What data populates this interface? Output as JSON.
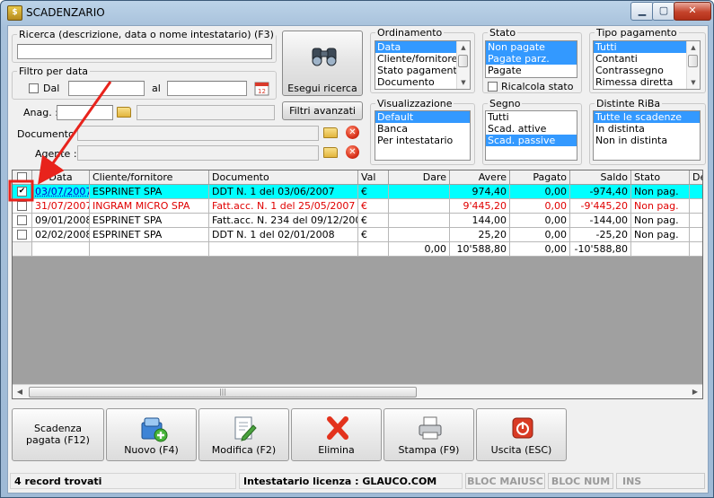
{
  "window": {
    "title": "SCADENZARIO",
    "min_glyph": "▁",
    "max_glyph": "▢",
    "close_glyph": "✕"
  },
  "search": {
    "label": "Ricerca (descrizione, data o nome intestatario) (F3)",
    "value": "",
    "button": "Esegui ricerca"
  },
  "date_filter": {
    "label": "Filtro per data",
    "from_label": "Dal",
    "from_value": "",
    "to_label": "al",
    "to_value": ""
  },
  "anag": {
    "label": "Anag. :",
    "code": "",
    "name": ""
  },
  "advanced_filters_button": "Filtri avanzati",
  "document": {
    "label": "Documento :",
    "value": ""
  },
  "agent": {
    "label": "Agente :",
    "value": ""
  },
  "ordinamento": {
    "title": "Ordinamento",
    "items": [
      "Data",
      "Cliente/fornitore",
      "Stato pagamento",
      "Documento"
    ],
    "selected": [
      0
    ]
  },
  "stato": {
    "title": "Stato",
    "items": [
      "Non pagate",
      "Pagate parz.",
      "Pagate"
    ],
    "selected": [
      0,
      1
    ],
    "recalc_label": "Ricalcola stato"
  },
  "tipo_pagamento": {
    "title": "Tipo pagamento",
    "items": [
      "Tutti",
      "Contanti",
      "Contrassegno",
      "Rimessa diretta"
    ],
    "selected": [
      0
    ]
  },
  "visualizzazione": {
    "title": "Visualizzazione",
    "items": [
      "Default",
      "Banca",
      "Per intestatario"
    ],
    "selected": [
      0
    ]
  },
  "segno": {
    "title": "Segno",
    "items": [
      "Tutti",
      "Scad. attive",
      "Scad. passive"
    ],
    "selected": [
      2
    ]
  },
  "distinte_riba": {
    "title": "Distinte RiBa",
    "items": [
      "Tutte le scadenze",
      "In distinta",
      "Non in distinta"
    ],
    "selected": [
      0
    ]
  },
  "grid": {
    "columns": [
      "",
      "Data",
      "Cliente/fornitore",
      "Documento",
      "Val",
      "Dare",
      "Avere",
      "Pagato",
      "Saldo",
      "Stato",
      "De"
    ],
    "rows": [
      {
        "checked": true,
        "highlight": true,
        "red": false,
        "data": "03/07/2007",
        "cliente": "ESPRINET SPA",
        "documento": "DDT N. 1 del 03/06/2007",
        "val": "€",
        "dare": "",
        "avere": "974,40",
        "pagato": "0,00",
        "saldo": "-974,40",
        "stato": "Non pag."
      },
      {
        "checked": false,
        "highlight": false,
        "red": true,
        "data": "31/07/2007",
        "cliente": "INGRAM MICRO SPA",
        "documento": "Fatt.acc. N. 1 del 25/05/2007",
        "val": "€",
        "dare": "",
        "avere": "9'445,20",
        "pagato": "0,00",
        "saldo": "-9'445,20",
        "stato": "Non pag."
      },
      {
        "checked": false,
        "highlight": false,
        "red": false,
        "data": "09/01/2008",
        "cliente": "ESPRINET SPA",
        "documento": "Fatt.acc. N. 234 del 09/12/2007",
        "val": "€",
        "dare": "",
        "avere": "144,00",
        "pagato": "0,00",
        "saldo": "-144,00",
        "stato": "Non pag."
      },
      {
        "checked": false,
        "highlight": false,
        "red": false,
        "data": "02/02/2008",
        "cliente": "ESPRINET SPA",
        "documento": "DDT N. 1 del 02/01/2008",
        "val": "€",
        "dare": "",
        "avere": "25,20",
        "pagato": "0,00",
        "saldo": "-25,20",
        "stato": "Non pag."
      }
    ],
    "totals": {
      "dare": "0,00",
      "avere": "10'588,80",
      "pagato": "0,00",
      "saldo": "-10'588,80"
    }
  },
  "toolbar": {
    "scadenza_pagata": "Scadenza pagata (F12)",
    "nuovo": "Nuovo (F4)",
    "modifica": "Modifica (F2)",
    "elimina": "Elimina",
    "stampa": "Stampa (F9)",
    "uscita": "Uscita (ESC)"
  },
  "status_bar": {
    "records": "4 record trovati",
    "license": "Intestatario licenza : GLAUCO.COM",
    "caps": "BLOC MAIUSC",
    "num": "BLOC NUM",
    "ins": "INS"
  },
  "icons": {
    "window": "app-icon",
    "search": "binoculars-icon",
    "calendar": "calendar-icon",
    "folder": "folder-icon",
    "clear": "clear-x-icon",
    "new": "new-doc-icon",
    "edit": "edit-pencil-icon",
    "delete": "red-x-icon",
    "print": "printer-icon",
    "exit": "power-icon"
  },
  "colors": {
    "highlight_row": "#00ffff",
    "selection": "#3399ff",
    "negative_text": "#e00000",
    "annotation_arrow": "#e8231c"
  }
}
